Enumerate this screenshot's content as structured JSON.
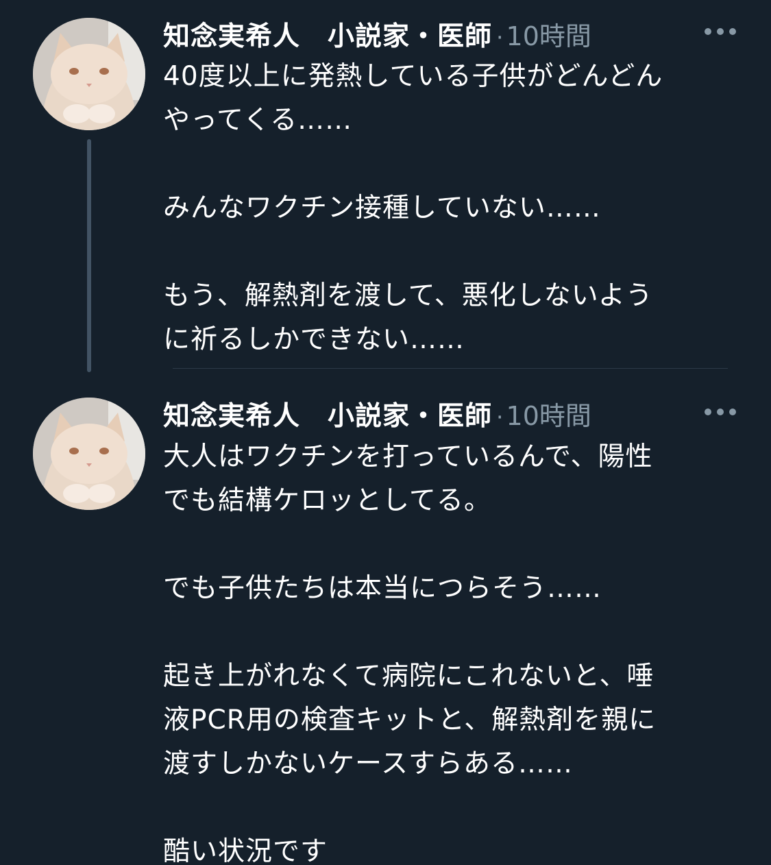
{
  "tweets": [
    {
      "author": "知念実希人　小説家・医師",
      "separator": "·",
      "time": "10時間",
      "lines": [
        "40度以上に発熱している子供がどんどん",
        "やってくる……",
        "",
        "みんなワクチン接種していない……",
        "",
        "もう、解熱剤を渡して、悪化しないよう",
        "に祈るしかできない……"
      ]
    },
    {
      "author": "知念実希人　小説家・医師",
      "separator": "·",
      "time": "10時間",
      "lines": [
        "大人はワクチンを打っているんで、陽性",
        "でも結構ケロッとしてる。",
        "",
        "でも子供たちは本当につらそう……",
        "",
        "起き上がれなくて病院にこれないと、唾",
        "液PCR用の検査キットと、解熱剤を親に",
        "渡すしかないケースすらある……",
        "",
        "酷い状況です"
      ]
    }
  ],
  "icons": {
    "avatar": "cat-avatar-icon",
    "more": "more-options-icon",
    "thread": "thread-line"
  },
  "colors": {
    "background": "#15202b",
    "text": "#ffffff",
    "muted": "#8899a6",
    "thread_line": "#425364"
  }
}
